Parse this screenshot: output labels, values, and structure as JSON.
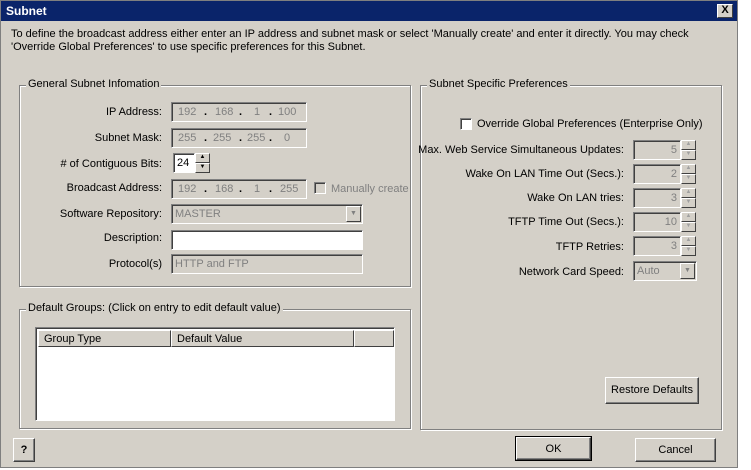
{
  "window": {
    "title": "Subnet",
    "close_label": "X"
  },
  "intro": "To define the broadcast address either enter an IP address and subnet mask or select 'Manually create' and enter it directly.  You may check 'Override Global Preferences' to use specific preferences for this Subnet.",
  "general": {
    "title": "General Subnet Infomation",
    "ip_label": "IP Address:",
    "ip": [
      "192",
      "168",
      "1",
      "100"
    ],
    "mask_label": "Subnet Mask:",
    "mask": [
      "255",
      "255",
      "255",
      "0"
    ],
    "bits_label": "# of Contiguous Bits:",
    "bits": "24",
    "broadcast_label": "Broadcast Address:",
    "broadcast": [
      "192",
      "168",
      "1",
      "255"
    ],
    "manual_label": "Manually create",
    "repo_label": "Software Repository:",
    "repo": "MASTER",
    "desc_label": "Description:",
    "desc": "",
    "protocol_label": "Protocol(s)",
    "protocol": "HTTP and FTP"
  },
  "groups": {
    "title": "Default Groups: (Click on entry to edit default value)",
    "columns": [
      "Group Type",
      "Default Value"
    ]
  },
  "prefs": {
    "title": "Subnet Specific Preferences",
    "override_label": "Override Global Preferences (Enterprise Only)",
    "rows": [
      {
        "label": "Max. Web Service Simultaneous Updates:",
        "value": "5"
      },
      {
        "label": "Wake On LAN Time Out (Secs.):",
        "value": "2"
      },
      {
        "label": "Wake On LAN tries:",
        "value": "3"
      },
      {
        "label": "TFTP Time Out (Secs.):",
        "value": "10"
      },
      {
        "label": "TFTP Retries:",
        "value": "3"
      }
    ],
    "nic_label": "Network Card Speed:",
    "nic": "Auto",
    "restore_label": "Restore Defaults"
  },
  "buttons": {
    "help": "?",
    "ok": "OK",
    "cancel": "Cancel"
  },
  "figure_id": "343246"
}
